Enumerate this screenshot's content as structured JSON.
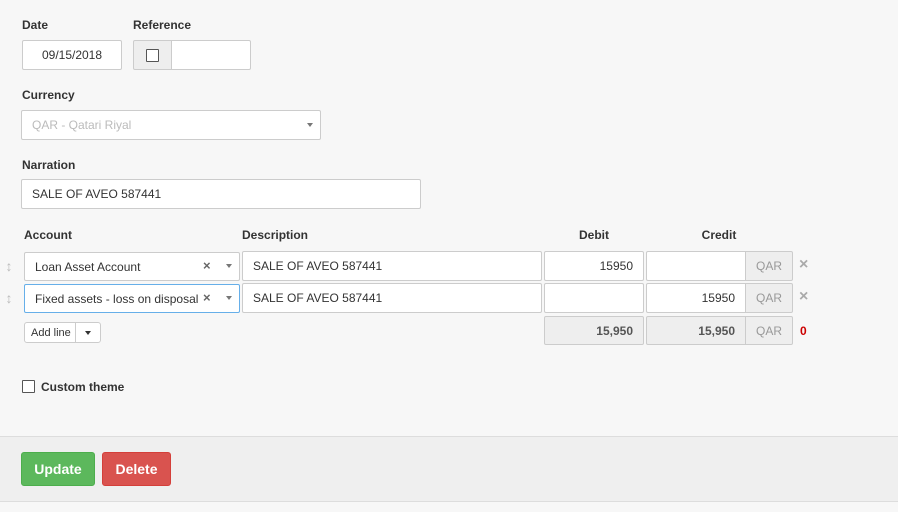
{
  "form": {
    "date_label": "Date",
    "date_value": "09/15/2018",
    "reference_label": "Reference",
    "reference_value": "",
    "currency_label": "Currency",
    "currency_value": "QAR - Qatari Riyal",
    "narration_label": "Narration",
    "narration_value": "SALE OF AVEO 587441"
  },
  "table": {
    "headers": {
      "account": "Account",
      "description": "Description",
      "debit": "Debit",
      "credit": "Credit"
    },
    "rows": [
      {
        "account": "Loan Asset Account",
        "description": "SALE OF AVEO 587441",
        "debit": "15950",
        "credit": "",
        "currency": "QAR"
      },
      {
        "account": "Fixed assets - loss on disposal",
        "description": "SALE OF AVEO 587441",
        "debit": "",
        "credit": "15950",
        "currency": "QAR"
      }
    ],
    "totals": {
      "debit": "15,950",
      "credit": "15,950",
      "currency": "QAR",
      "difference": "0"
    },
    "add_line_label": "Add line"
  },
  "options": {
    "custom_theme_label": "Custom theme"
  },
  "actions": {
    "update_label": "Update",
    "delete_label": "Delete"
  },
  "colors": {
    "update": "#5cb85c",
    "delete": "#d9534f",
    "difference": "#cc0000"
  }
}
